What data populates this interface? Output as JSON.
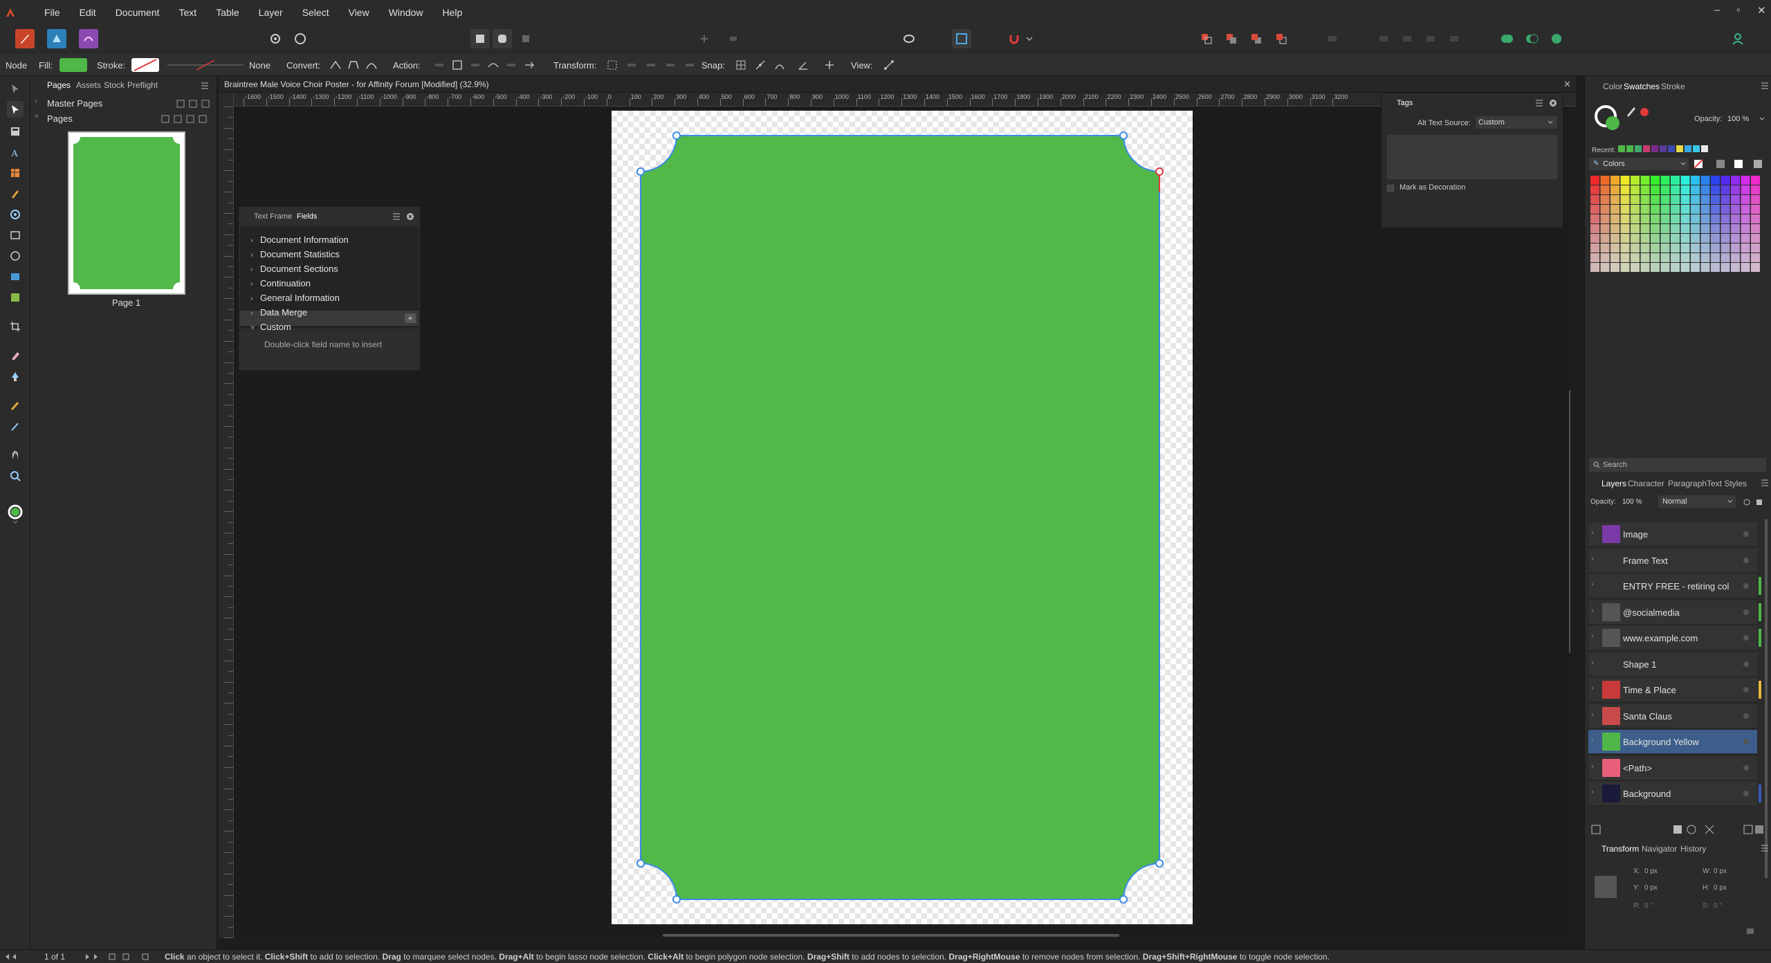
{
  "app": {
    "menus": [
      "File",
      "Edit",
      "Document",
      "Text",
      "Table",
      "Layer",
      "Select",
      "View",
      "Window",
      "Help"
    ],
    "window_controls": [
      "–",
      "▫",
      "✕"
    ]
  },
  "context_bar": {
    "node_label": "Node",
    "fill_label": "Fill:",
    "fill_color": "#4fb748",
    "stroke_label": "Stroke:",
    "stroke_value": "None",
    "convert_label": "Convert:",
    "action_label": "Action:",
    "transform_label": "Transform:",
    "snap_label": "Snap:",
    "view_label": "View:"
  },
  "pages_panel": {
    "tabs": [
      "Pages",
      "Assets",
      "Stock",
      "Preflight"
    ],
    "master_pages_label": "Master Pages",
    "pages_label": "Pages",
    "page_caption": "Page 1"
  },
  "document": {
    "title": "Braintree Male Voice Choir Poster - for Affinity Forum [Modified] (32.9%)",
    "ruler_h_labels": [
      "-1600",
      "-1500",
      "-1400",
      "-1300",
      "-1200",
      "-1100",
      "-1000",
      "-900",
      "-800",
      "-700",
      "-600",
      "-500",
      "-400",
      "-300",
      "-200",
      "-100",
      "0",
      "100",
      "200",
      "300",
      "400",
      "500",
      "600",
      "700",
      "800",
      "900",
      "1000",
      "1100",
      "1200",
      "1300",
      "1400",
      "1500",
      "1600",
      "1700",
      "1800",
      "1900",
      "2000",
      "2100",
      "2200",
      "2300",
      "2400",
      "2500",
      "2600",
      "2700",
      "2800",
      "2900",
      "3000",
      "3100",
      "3200"
    ],
    "shape_fill": "#52b84a"
  },
  "fields_panel": {
    "tabs": [
      "Text Frame",
      "Fields"
    ],
    "items": [
      "Document Information",
      "Document Statistics",
      "Document Sections",
      "Continuation",
      "General Information",
      "Data Merge",
      "Custom"
    ],
    "hint": "Double-click field name to insert"
  },
  "tags_panel": {
    "title": "Tags",
    "alt_text_source_label": "Alt Text Source:",
    "alt_text_source_value": "Custom",
    "mark_decoration_label": "Mark as Decoration"
  },
  "color_panel": {
    "tabs": [
      "Color",
      "Swatches",
      "Stroke"
    ],
    "opacity_label": "Opacity:",
    "opacity_value": "100 %",
    "recent_label": "Recent:",
    "recent_colors": [
      "#4fb748",
      "#4fb748",
      "#3fa86b",
      "#c83a6e",
      "#7a2b8c",
      "#5a3a9c",
      "#3a4ab0",
      "#e8d84a",
      "#3aa8e8",
      "#3ac8e8",
      "#e8e8e8"
    ],
    "palette_label": "Colors",
    "search_placeholder": "Search"
  },
  "layers_panel": {
    "tabs": [
      "Layers",
      "Character",
      "Paragraph",
      "Text Styles"
    ],
    "opacity_label": "Opacity:",
    "opacity_value": "100 %",
    "blend_mode": "Normal",
    "layers": [
      {
        "name": "Image",
        "thumb": "#7a3aa8",
        "selected": false,
        "tag": ""
      },
      {
        "name": "Frame Text",
        "thumb": "#333333",
        "selected": false,
        "tag": ""
      },
      {
        "name": "ENTRY FREE - retiring col",
        "thumb": "#333333",
        "selected": false,
        "tag": "#4fb748"
      },
      {
        "name": "@socialmedia",
        "thumb": "#555555",
        "selected": false,
        "tag": "#4fb748"
      },
      {
        "name": "www.example.com",
        "thumb": "#555555",
        "selected": false,
        "tag": "#4fb748"
      },
      {
        "name": "Shape 1",
        "thumb": "#333333",
        "selected": false,
        "tag": ""
      },
      {
        "name": "Time & Place",
        "thumb": "#c83a3a",
        "selected": false,
        "tag": "#e8b83a"
      },
      {
        "name": "Santa Claus",
        "thumb": "#c84a4a",
        "selected": false,
        "tag": ""
      },
      {
        "name": "Background Yellow",
        "thumb": "#4fb748",
        "selected": true,
        "tag": ""
      },
      {
        "name": "<Path>",
        "thumb": "#e8607a",
        "selected": false,
        "tag": ""
      },
      {
        "name": "Background",
        "thumb": "#1a1a3a",
        "selected": false,
        "tag": "#3a5ab8"
      }
    ]
  },
  "transform_panel": {
    "tabs": [
      "Transform",
      "Navigator",
      "History"
    ],
    "x_label": "X:",
    "x_value": "0 px",
    "y_label": "Y:",
    "y_value": "0 px",
    "w_label": "W:",
    "w_value": "0 px",
    "h_label": "H:",
    "h_value": "0 px",
    "r_label": "R:",
    "r_value": "0 °",
    "s_label": "S:",
    "s_value": "0 °"
  },
  "status_bar": {
    "page_count": "1 of 1",
    "hint_parts": [
      {
        "b": "Click",
        "t": " an object to select it. "
      },
      {
        "b": "Click+Shift",
        "t": " to add to selection. "
      },
      {
        "b": "Drag",
        "t": " to marquee select nodes. "
      },
      {
        "b": "Drag+Alt",
        "t": " to begin lasso node selection. "
      },
      {
        "b": "Click+Alt",
        "t": " to begin polygon node selection. "
      },
      {
        "b": "Drag+Shift",
        "t": " to add nodes to selection. "
      },
      {
        "b": "Drag+RightMouse",
        "t": " to remove nodes from selection. "
      },
      {
        "b": "Drag+Shift+RightMouse",
        "t": " to toggle node selection."
      }
    ]
  }
}
